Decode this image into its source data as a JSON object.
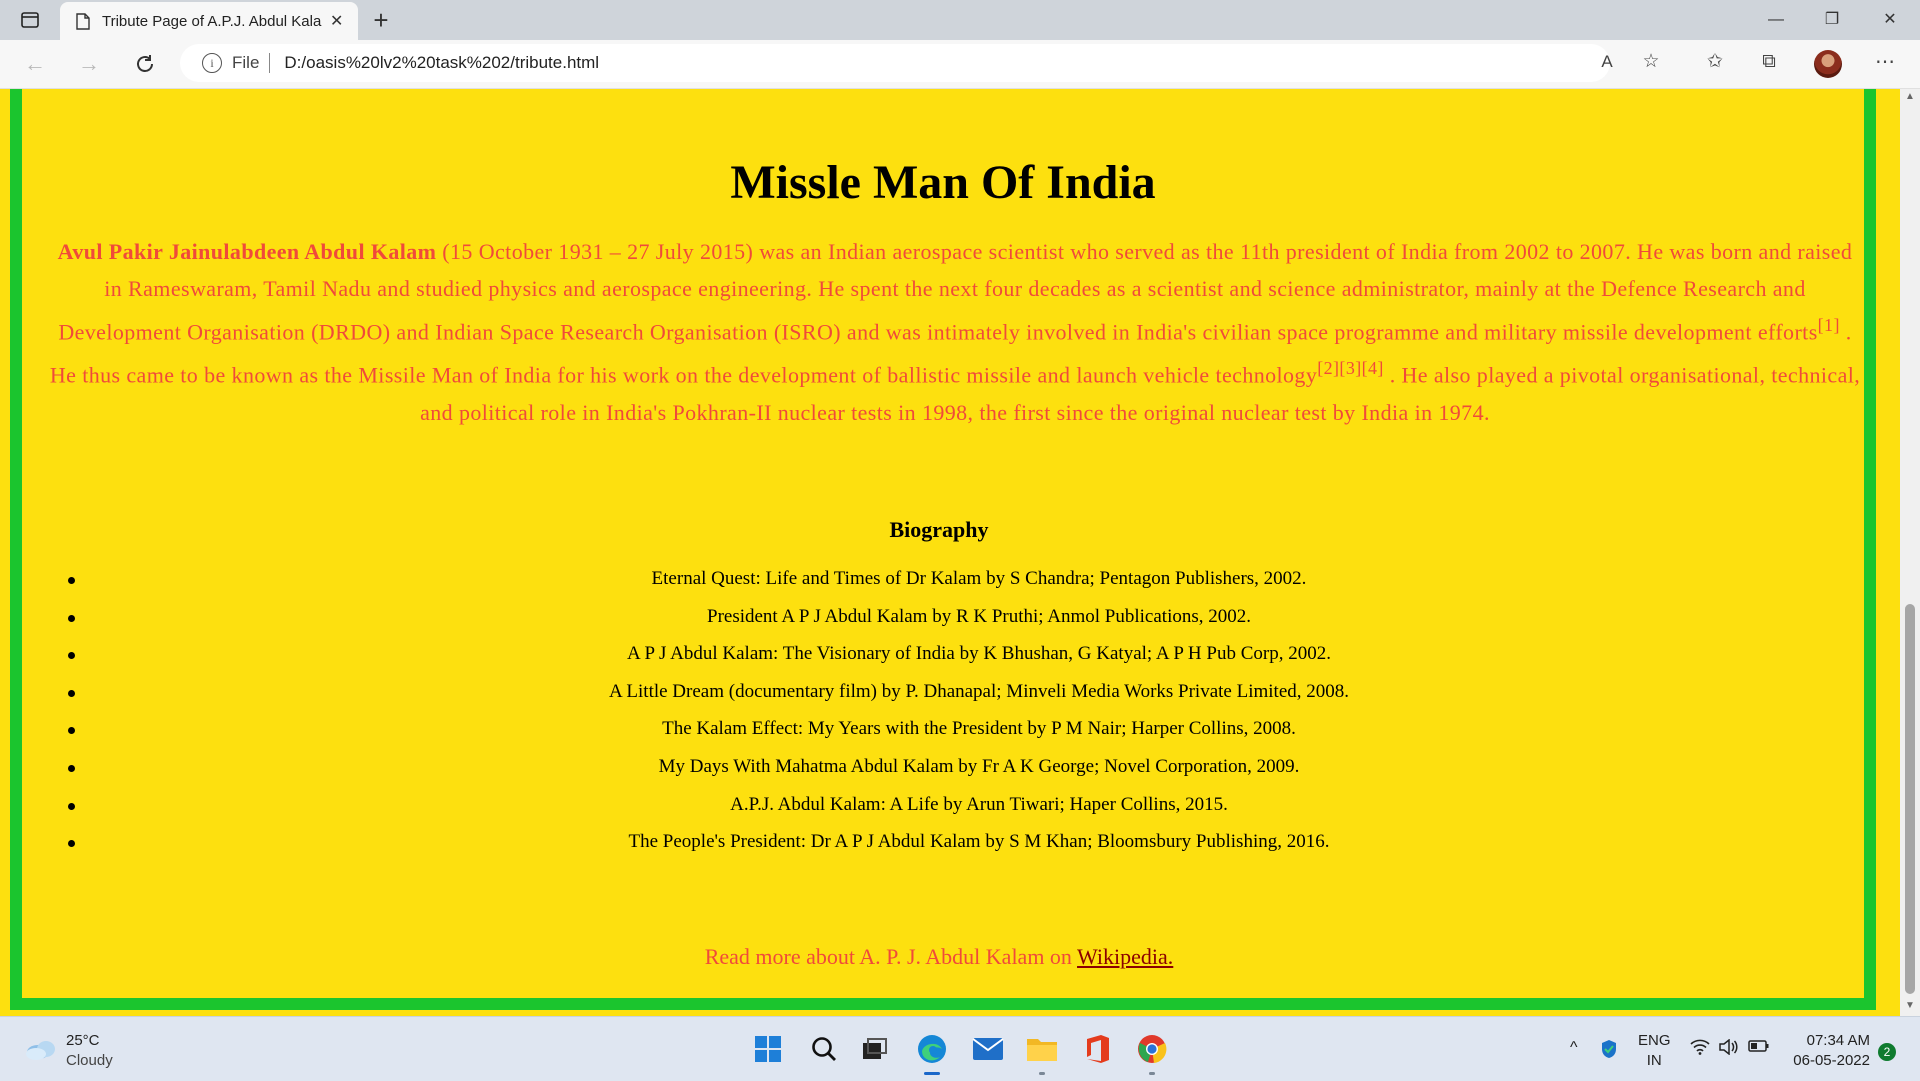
{
  "browser": {
    "tab_title": "Tribute Page of A.P.J. Abdul Kalam",
    "tab_close": "✕",
    "new_tab": "+",
    "address_scheme": "File",
    "address_url": "D:/oasis%20lv2%20task%202/tribute.html",
    "controls": {
      "minimize": "—",
      "restore": "❐",
      "close": "✕"
    }
  },
  "page": {
    "heading": "Missle Man Of India",
    "intro": {
      "name": "Avul Pakir Jainulabdeen Abdul Kalam",
      "text_1": " (15 October 1931 – 27 July 2015) was an Indian aerospace scientist who served as the 11th president of India from 2002 to 2007. He was born and raised in Rameswaram, Tamil Nadu and studied physics and aerospace engineering. He spent the next four decades as a scientist and science administrator, mainly at the Defence Research and Development Organisation (DRDO) and Indian Space Research Organisation (ISRO) and was intimately involved in India's civilian space programme and military missile development efforts",
      "ref_1": "[1]",
      "text_2": " . He thus came to be known as the Missile Man of India for his work on the development of ballistic missile and launch vehicle technology",
      "ref_2": "[2][3][4]",
      "text_3": " . He also played a pivotal organisational, technical, and political role in India's Pokhran-II nuclear tests in 1998, the first since the original nuclear test by India in 1974."
    },
    "biography_title": "Biography",
    "biography": [
      "Eternal Quest: Life and Times of Dr Kalam by S Chandra; Pentagon Publishers, 2002.",
      "President A P J Abdul Kalam by R K Pruthi; Anmol Publications, 2002.",
      "A P J Abdul Kalam: The Visionary of India by K Bhushan, G Katyal; A P H Pub Corp, 2002.",
      "A Little Dream (documentary film) by P. Dhanapal; Minveli Media Works Private Limited, 2008.",
      "The Kalam Effect: My Years with the President by P M Nair; Harper Collins, 2008.",
      "My Days With Mahatma Abdul Kalam by Fr A K George; Novel Corporation, 2009.",
      "A.P.J. Abdul Kalam: A Life by Arun Tiwari; Haper Collins, 2015.",
      "The People's President: Dr A P J Abdul Kalam by S M Khan; Bloomsbury Publishing, 2016."
    ],
    "readmore_text": "Read more about A. P. J. Abdul Kalam on ",
    "readmore_link": "Wikipedia."
  },
  "taskbar": {
    "weather_temp": "25°C",
    "weather_desc": "Cloudy",
    "lang_1": "ENG",
    "lang_2": "IN",
    "time": "07:34 AM",
    "date": "06-05-2022",
    "notifications": "2"
  },
  "colors": {
    "page_bg": "#fde00f",
    "border": "#1bc52e",
    "intro_text": "#f04a3a"
  }
}
